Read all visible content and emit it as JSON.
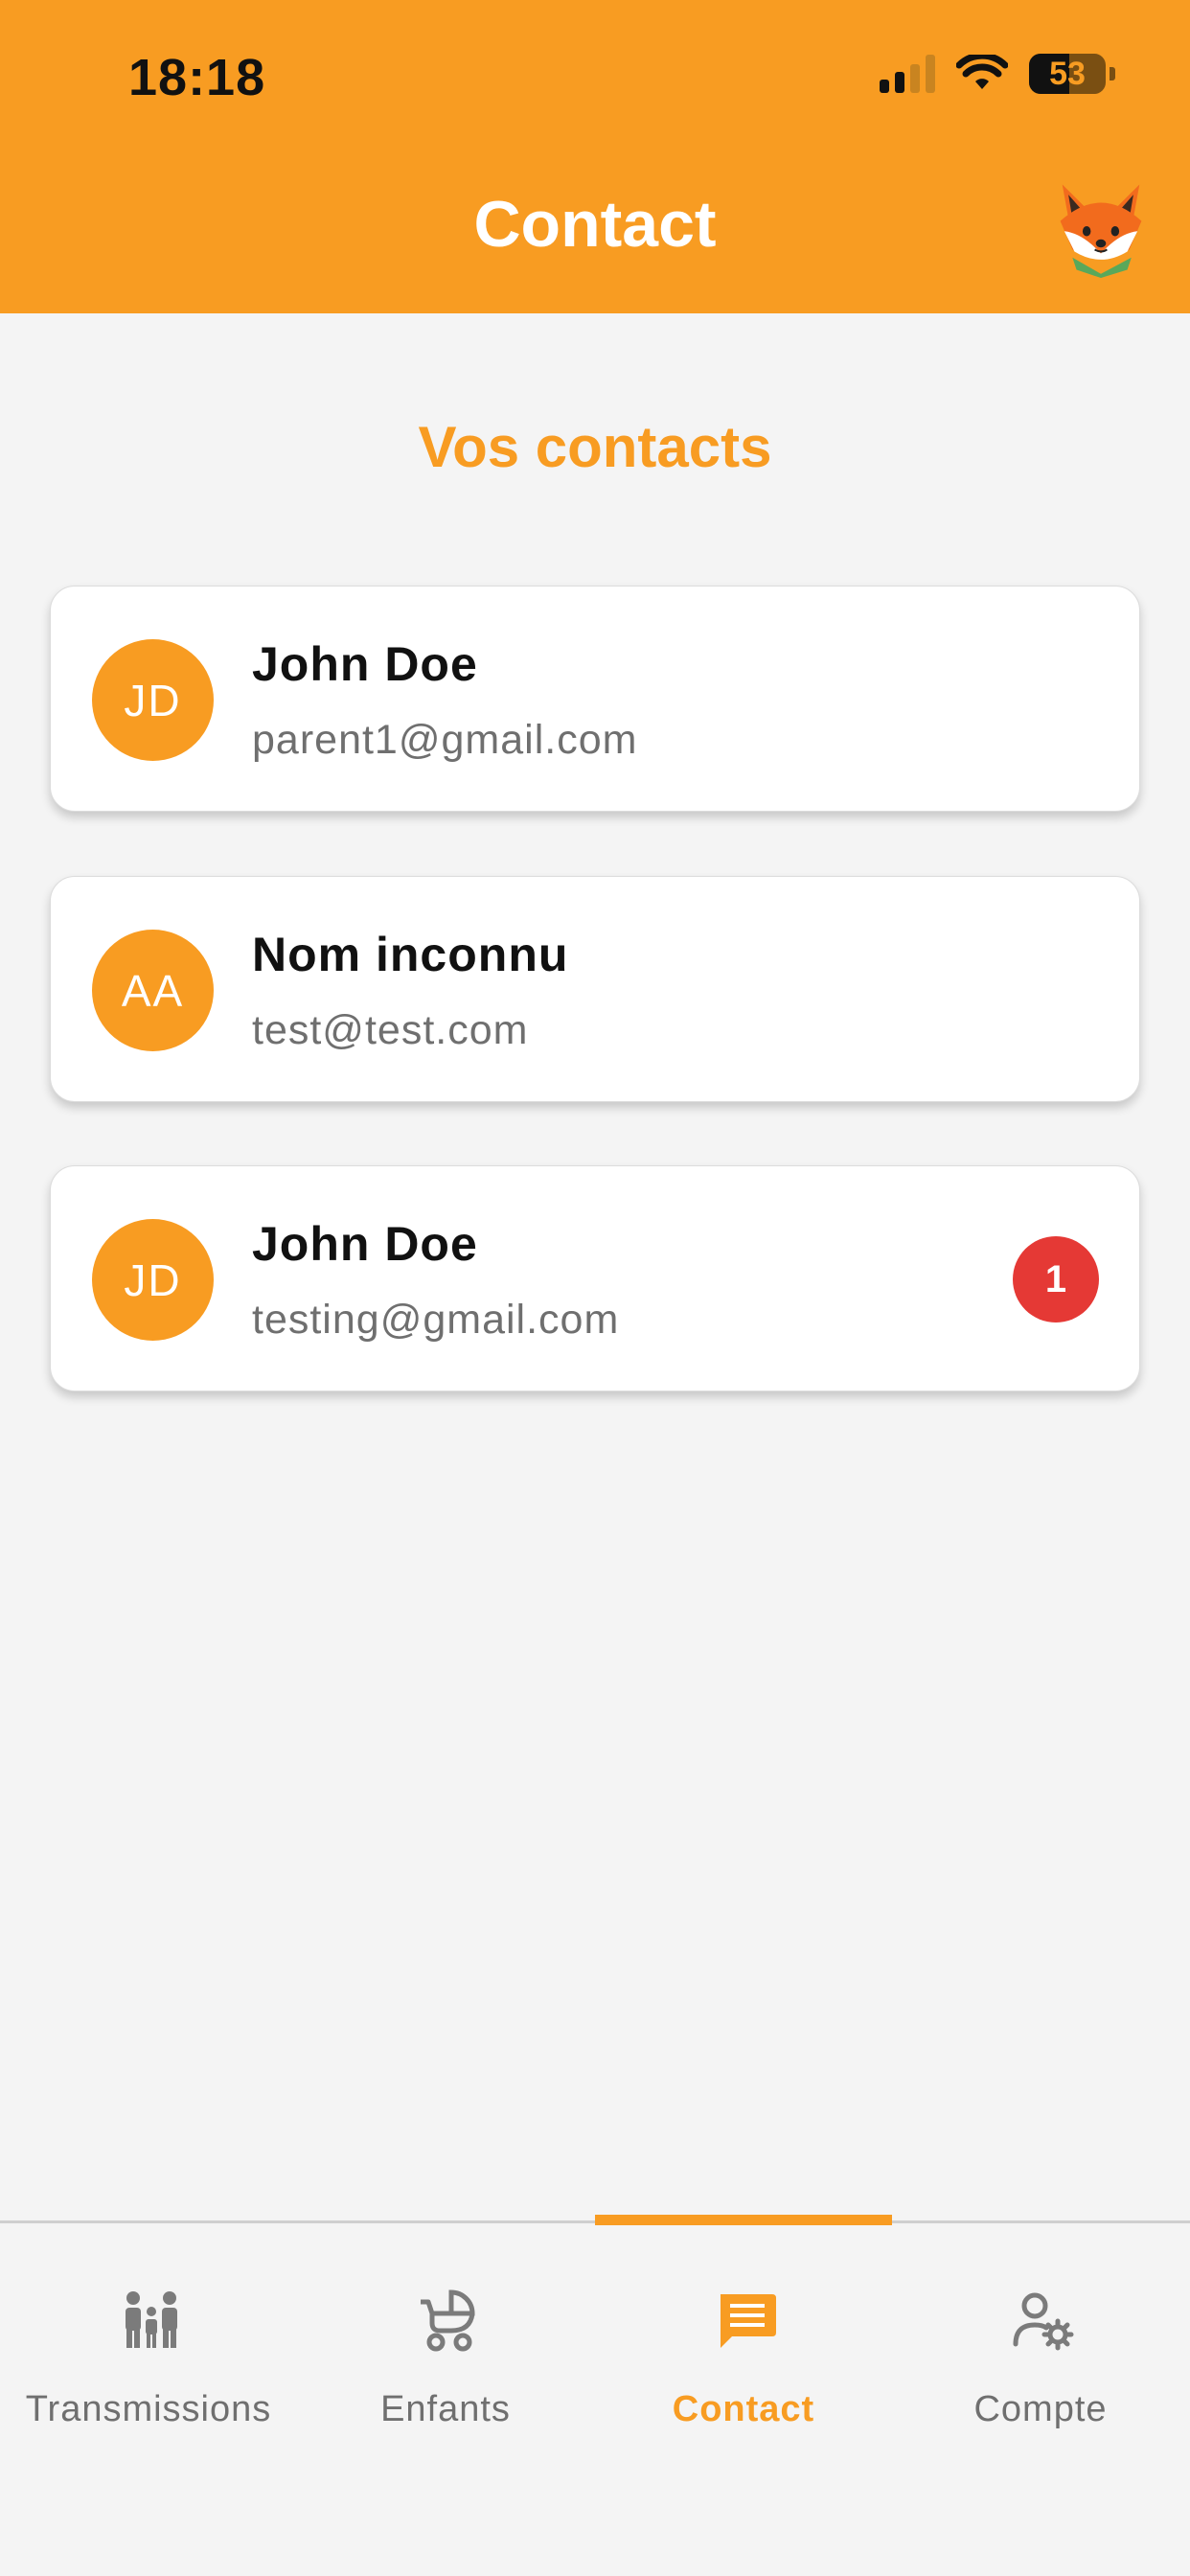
{
  "status_bar": {
    "time": "18:18",
    "battery": "53"
  },
  "header": {
    "title": "Contact"
  },
  "section": {
    "title": "Vos contacts"
  },
  "contacts": [
    {
      "initials": "JD",
      "name": "John Doe",
      "email": "parent1@gmail.com",
      "unread": ""
    },
    {
      "initials": "AA",
      "name": "Nom inconnu",
      "email": "test@test.com",
      "unread": ""
    },
    {
      "initials": "JD",
      "name": "John Doe",
      "email": "testing@gmail.com",
      "unread": "1"
    }
  ],
  "tabs": [
    {
      "label": "Transmissions",
      "icon": "family-icon",
      "active": false
    },
    {
      "label": "Enfants",
      "icon": "stroller-icon",
      "active": false
    },
    {
      "label": "Contact",
      "icon": "chat-icon",
      "active": true
    },
    {
      "label": "Compte",
      "icon": "account-settings-icon",
      "active": false
    }
  ],
  "colors": {
    "accent": "#f89c22",
    "badge": "#e53935",
    "inactive": "#6f6f6f",
    "background": "#f4f4f4"
  }
}
